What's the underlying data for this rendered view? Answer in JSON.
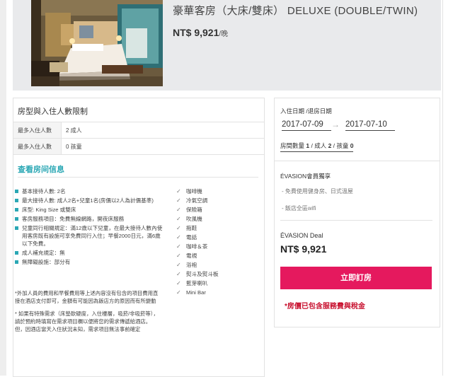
{
  "room": {
    "title": "豪華客房（大床/雙床） DELUXE (DOUBLE/TWIN)",
    "price": "NT$ 9,921",
    "price_unit": "/晚"
  },
  "occupancy": {
    "section_title": "房型與入住人數限制",
    "rows": [
      {
        "label": "最多入住人數",
        "value": "2 成人"
      },
      {
        "label": "最多入住人數",
        "value": "0 孩童"
      }
    ]
  },
  "info_link": "查看房间信息",
  "features": [
    "基本接待人數: 2名",
    "最大接待人數: 成人2名+兒童1名(房價以2人為計價基準)",
    "床型: King Size 或雙床",
    "客房服務項目：免費無線網路，開夜床服務",
    "兒童同行相關規定：滿12歲以下兒童，在最大接待人數內使用客房既有設施可享免費同行入住；早餐2000日元，滿6歲以下免費。",
    "成人補充規定：無",
    "無障礙設施：部分有"
  ],
  "amenities": [
    "咖啡機",
    "冷氣空調",
    "保險箱",
    "吹風機",
    "拖鞋",
    "電話",
    "咖啡＆茶",
    "電視",
    "浴袍",
    "熨斗及熨斗板",
    "藍芽喇叭",
    "Mini Bar"
  ],
  "notes": [
    "*外加人員的費用和早餐費用等上述內容沒有包含的項目費用直接在酒店支付即可，金額有可能因為飯店方的原因而有所變動",
    "* 如果有特殊需求（床墊軟硬度，入住樓層，吸菸/非吸菸等），請於預約時填寫在需求項目欄以便將您的需求傳遞給酒店。但，因酒店當天入住狀況未知，需求項目無法事前確定"
  ],
  "booking": {
    "dates_label": "入住日期 /退房日期",
    "checkin": "2017-07-09",
    "checkout": "2017-07-10",
    "guests_prefix": "房間數量 ",
    "rooms_count": "1",
    "adults_prefix": " / 成人 ",
    "adults_count": "2",
    "children_prefix": " / 孩童 ",
    "children_count": "0",
    "perk_title": "ÉVASION會員獨享",
    "perks": [
      "- 免費使用健身房、日式溫屋",
      "- 飯店全區wifi"
    ],
    "deal_label": "ÉVASION Deal",
    "deal_price": "NT$ 9,921",
    "book_button": "立即訂房",
    "tax_note": "*房價已包含服務費與稅金"
  },
  "colors": {
    "accent_teal": "#2aa7b4",
    "book_button_bg": "#e5195e",
    "tax_note": "#c8102e"
  }
}
